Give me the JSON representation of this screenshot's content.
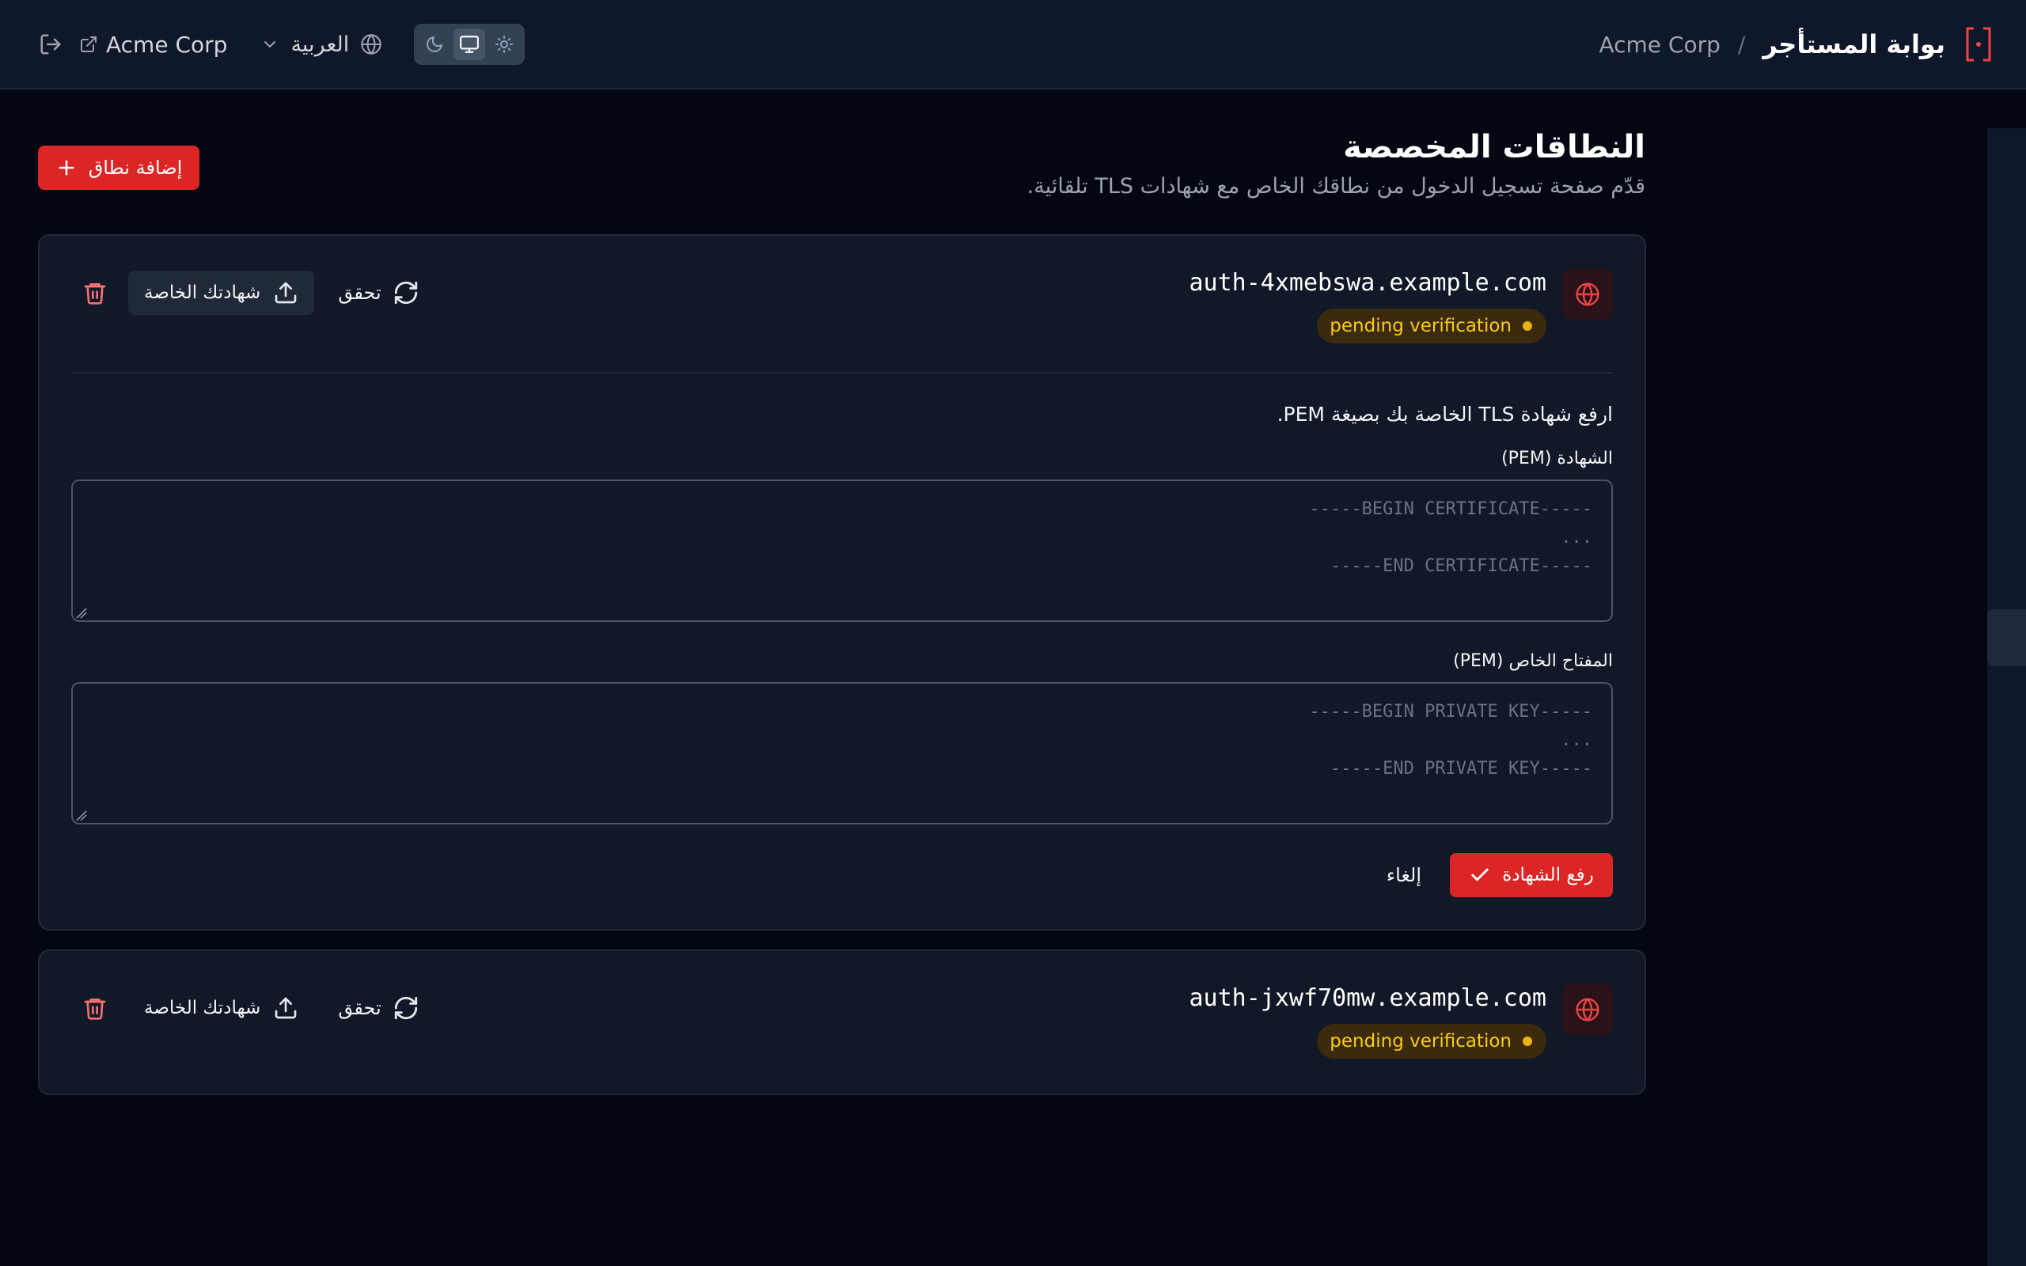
{
  "header": {
    "portal_title": "بوابة المستأجر",
    "separator": "/",
    "tenant_name": "Acme Corp",
    "tenant_link_label": "Acme Corp",
    "language": "العربية",
    "theme": {
      "options": [
        "light",
        "system",
        "dark"
      ],
      "selected": "system"
    },
    "icons": {
      "logo": "bracket-dot-logo",
      "signout": "sign-out-icon",
      "external": "external-link-icon",
      "language": "globe-icon",
      "dropdown": "chevron-down-icon",
      "theme_light": "sun-icon",
      "theme_system": "monitor-icon",
      "theme_dark": "moon-icon"
    }
  },
  "page": {
    "title": "النطاقات المخصصة",
    "subtitle": "قدّم صفحة تسجيل الدخول من نطاقك الخاص مع شهادات TLS تلقائية.",
    "add_button": "إضافة نطاق"
  },
  "domains": [
    {
      "name": "auth-4xmebswa.example.com",
      "status": "pending verification",
      "verify_label": "تحقق",
      "cert_label": "شهادتك الخاصة",
      "expanded": true,
      "upload": {
        "hint": "ارفع شهادة TLS الخاصة بك بصيغة PEM.",
        "cert_label": "الشهادة (PEM)",
        "cert_placeholder": [
          "-----BEGIN CERTIFICATE-----",
          "...",
          "-----END CERTIFICATE-----"
        ],
        "key_label": "المفتاح الخاص (PEM)",
        "key_placeholder": [
          "-----BEGIN PRIVATE KEY-----",
          "...",
          "-----END PRIVATE KEY-----"
        ],
        "submit_label": "رفع الشهادة",
        "cancel_label": "إلغاء"
      }
    },
    {
      "name": "auth-jxwf70mw.example.com",
      "status": "pending verification",
      "verify_label": "تحقق",
      "cert_label": "شهادتك الخاصة",
      "expanded": false
    }
  ],
  "colors": {
    "background": "#030712",
    "header": "#0f172a",
    "card": "#111827",
    "accent": "#dc2626",
    "pending": "#facc15"
  }
}
